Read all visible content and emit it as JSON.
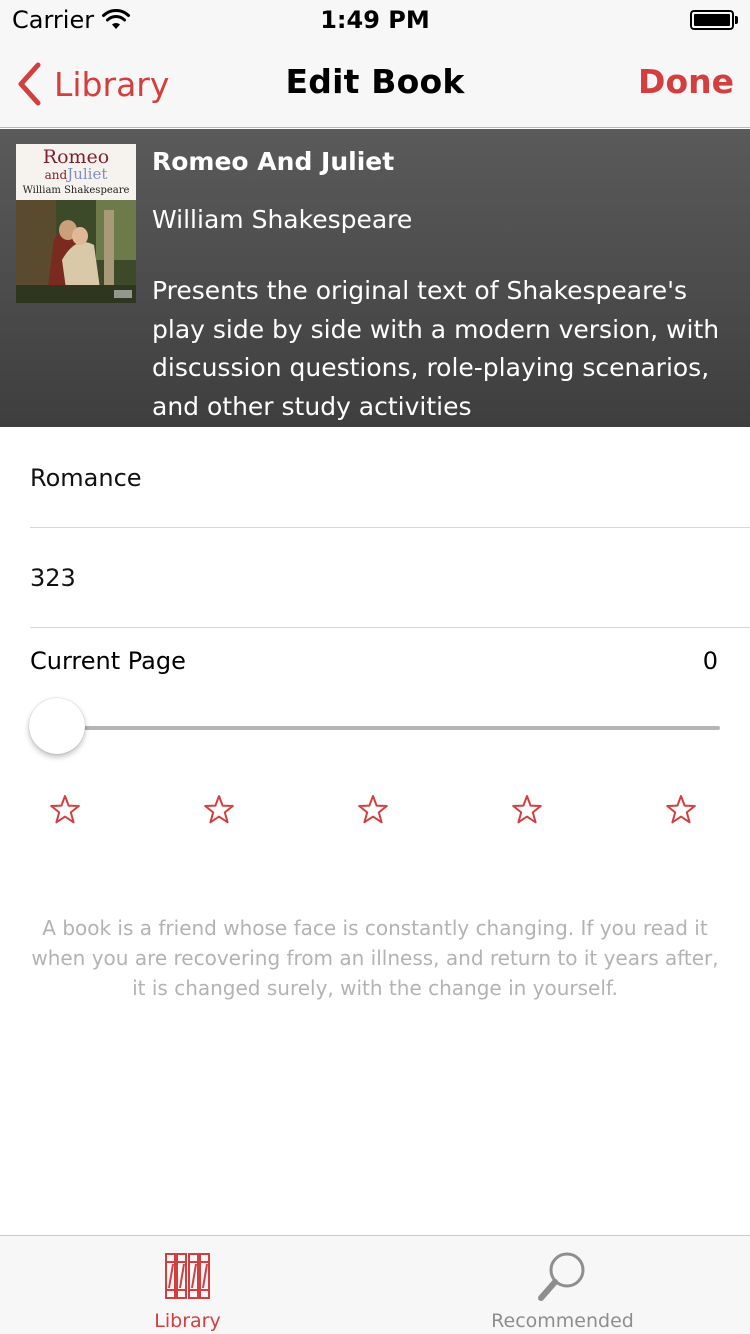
{
  "status_bar": {
    "carrier": "Carrier",
    "time": "1:49 PM",
    "icons": [
      "wifi-icon",
      "battery-icon"
    ]
  },
  "nav": {
    "back_label": "Library",
    "back_icon": "chevron-left-icon",
    "title": "Edit Book",
    "done_label": "Done",
    "accent_color": "#d33f3f"
  },
  "book": {
    "cover": {
      "title_line1": "Romeo",
      "title_and": "and",
      "title_line2": "Juliet",
      "author": "William Shakespeare"
    },
    "title": "Romeo And Juliet",
    "author": "William Shakespeare",
    "description": "Presents the original text of Shakespeare's play side by side with a modern version, with discussion questions, role-playing scenarios, and other study activities"
  },
  "form": {
    "genre_value": "Romance",
    "pages_value": "323",
    "current_page_label": "Current Page",
    "current_page_value": "0",
    "slider_fraction": 0,
    "rating": 0,
    "rating_max": 5,
    "star_icon": "star-outline-icon"
  },
  "quote": "A book is a friend whose face is constantly changing. If you read it when you are recovering from an illness, and return to it years after, it is changed surely, with the change in yourself.",
  "tab_bar": {
    "tabs": [
      {
        "label": "Library",
        "icon": "books-icon",
        "selected": true,
        "color": "#d33f3f"
      },
      {
        "label": "Recommended",
        "icon": "magnifier-icon",
        "selected": false,
        "color": "#8e8e8e"
      }
    ]
  }
}
